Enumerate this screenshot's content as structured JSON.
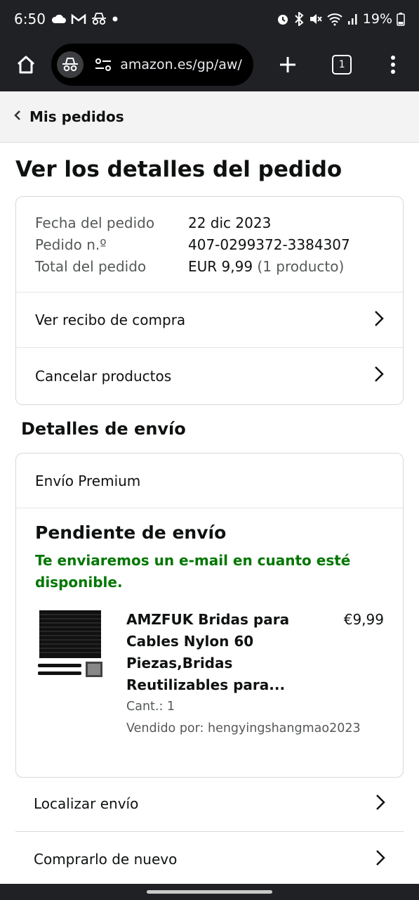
{
  "status_bar": {
    "time": "6:50",
    "battery": "19%",
    "left_icons": [
      "cloud-icon",
      "gmail-icon",
      "incognito-icon",
      "dot-icon"
    ],
    "right_icons": [
      "alarm-icon",
      "bluetooth-icon",
      "mute-icon",
      "wifi-icon",
      "signal-icon",
      "battery-icon"
    ]
  },
  "browser": {
    "url": "amazon.es/gp/aw/",
    "tab_count": "1"
  },
  "breadcrumb": {
    "label": "Mis pedidos"
  },
  "page_title": "Ver los detalles del pedido",
  "order_summary": {
    "rows": [
      {
        "label": "Fecha del pedido",
        "value": "22 dic 2023",
        "extra": ""
      },
      {
        "label": "Pedido n.º",
        "value": "407-0299372-3384307",
        "extra": ""
      },
      {
        "label": "Total del pedido",
        "value": "EUR 9,99",
        "extra": "(1 producto)"
      }
    ],
    "links": [
      "Ver recibo de compra",
      "Cancelar productos"
    ]
  },
  "shipping": {
    "section_title": "Detalles de envío",
    "type": "Envío Premium",
    "status": "Pendiente de envío",
    "message": "Te enviaremos un e-mail en cuanto esté disponible.",
    "item": {
      "title": "AMZFUK Bridas para Cables Nylon 60 Piezas,Bridas Reutilizables para...",
      "quantity": "Cant.: 1",
      "seller": "Vendido por: hengyingshangmao2023",
      "price": "€9,99"
    }
  },
  "actions": {
    "track": "Localizar envío",
    "buy_again": "Comprarlo de nuevo"
  },
  "colors": {
    "accent_green": "#007600",
    "chrome_dark": "#202124",
    "breadcrumb_bg": "#f3f3f3"
  }
}
